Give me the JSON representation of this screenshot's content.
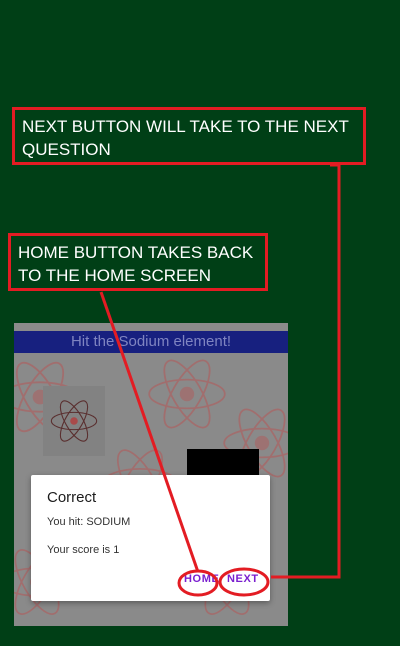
{
  "annotations": {
    "next_callout": "NEXT BUTTON WILL TAKE TO THE NEXT QUESTION",
    "home_callout": "HOME BUTTON TAKES BACK TO THE HOME SCREEN"
  },
  "app": {
    "prompt": "Hit the Sodium element!"
  },
  "dialog": {
    "title": "Correct",
    "message": "You hit: SODIUM",
    "score": "Your score is 1",
    "home_label": "HOME",
    "next_label": "NEXT"
  },
  "colors": {
    "background": "#003f16",
    "callout_red": "#e31c23",
    "app_bar": "#17207f",
    "dialog_button": "#7a1fcf"
  },
  "icons": {
    "atom": "atom-icon"
  }
}
